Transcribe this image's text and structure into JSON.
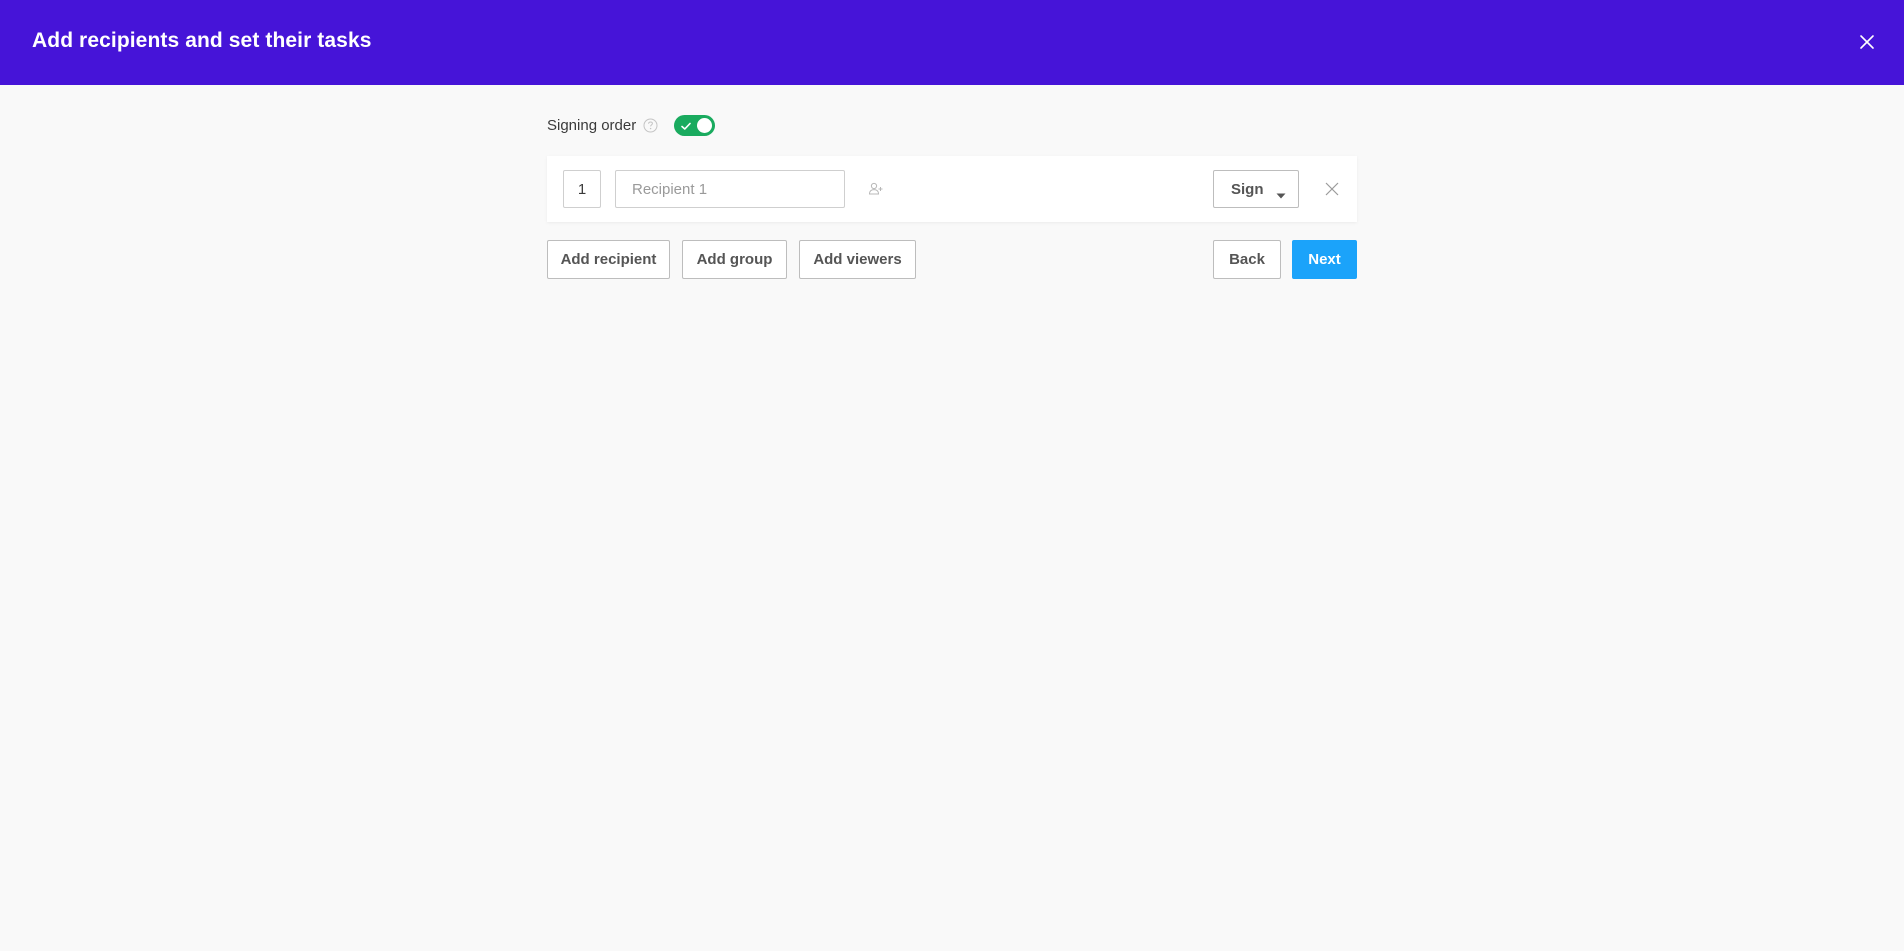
{
  "header": {
    "title": "Add recipients and set their tasks",
    "close_icon": "close-icon",
    "background": "#4614d8"
  },
  "signing_order": {
    "label": "Signing order",
    "help_icon": "question-circle-icon",
    "enabled": true,
    "toggle_color": "#1aab5f"
  },
  "recipients": [
    {
      "order": "1",
      "name_value": "",
      "name_placeholder": "Recipient 1",
      "contacts_icon": "add-contact-icon",
      "role": "Sign",
      "remove_icon": "close-icon"
    }
  ],
  "actions": {
    "add_recipient": "Add recipient",
    "add_group": "Add group",
    "add_viewers": "Add viewers",
    "back": "Back",
    "next": "Next",
    "next_color": "#1ba3fa"
  }
}
